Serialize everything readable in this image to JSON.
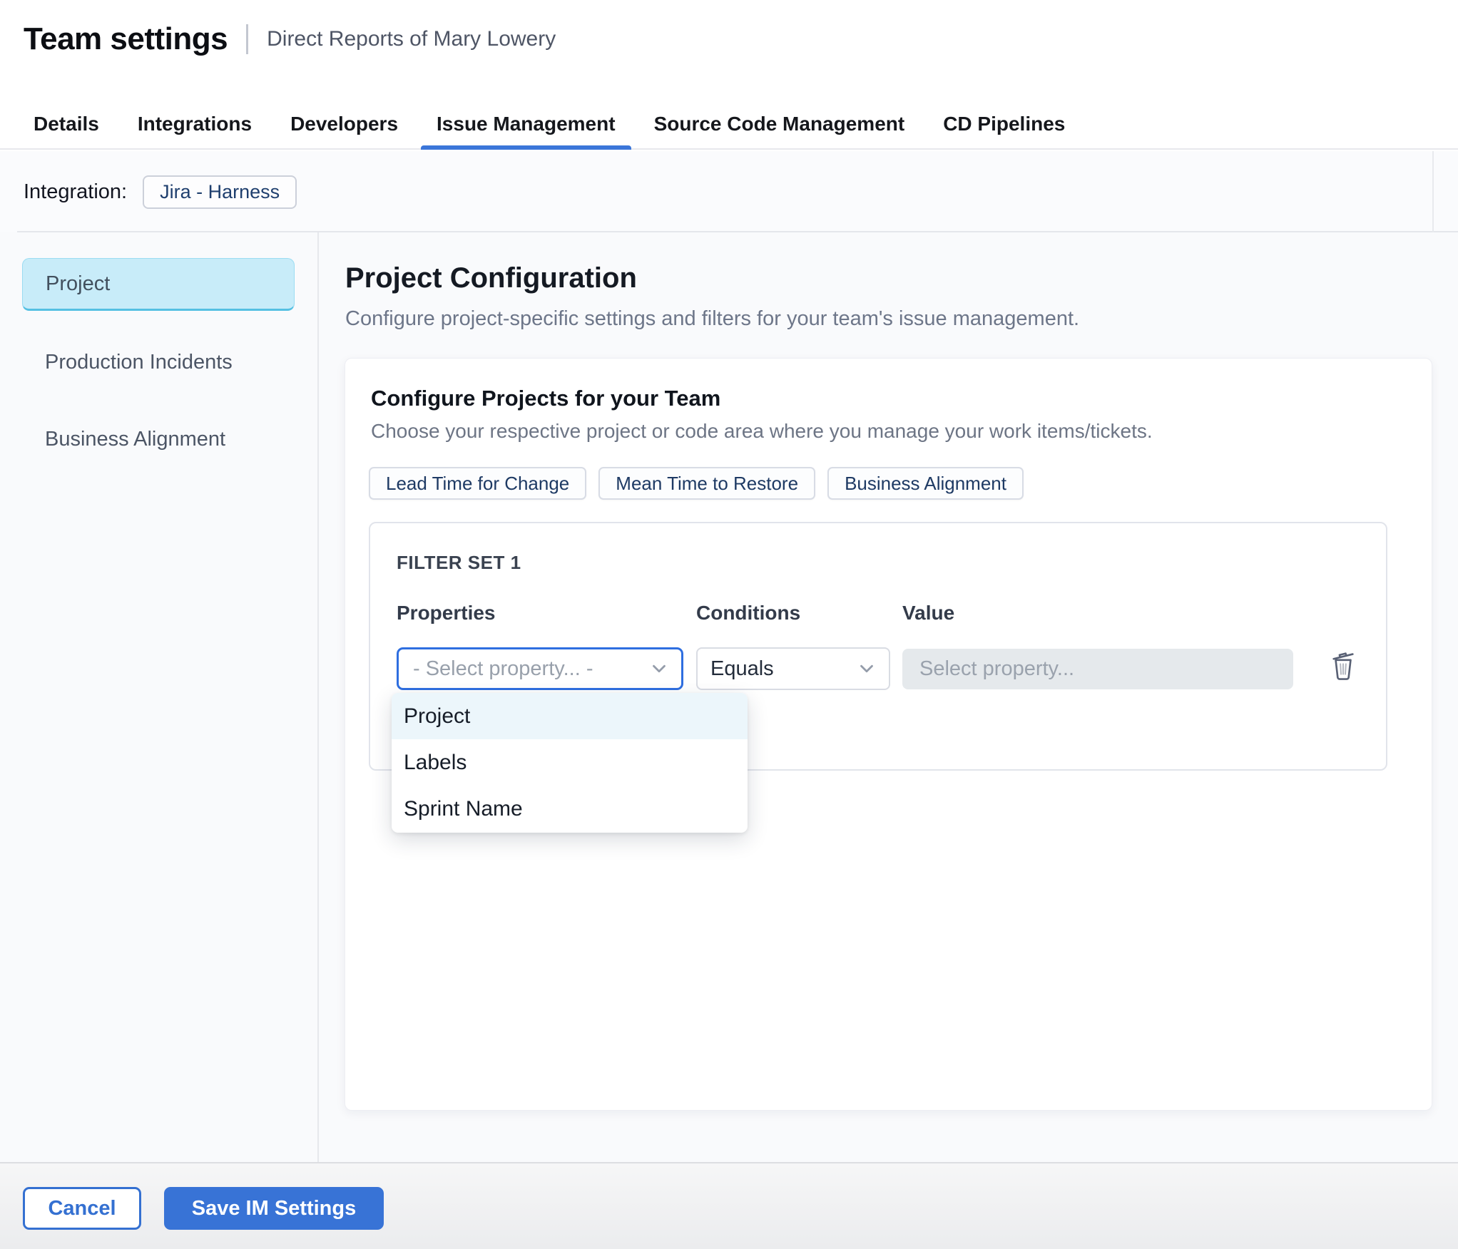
{
  "header": {
    "title": "Team settings",
    "subtitle": "Direct Reports of Mary Lowery"
  },
  "tabs": [
    {
      "label": "Details",
      "active": false
    },
    {
      "label": "Integrations",
      "active": false
    },
    {
      "label": "Developers",
      "active": false
    },
    {
      "label": "Issue Management",
      "active": true
    },
    {
      "label": "Source Code Management",
      "active": false
    },
    {
      "label": "CD Pipelines",
      "active": false
    }
  ],
  "integration": {
    "label": "Integration:",
    "chip_label": "Jira - Harness"
  },
  "sidebar": {
    "items": [
      {
        "label": "Project",
        "selected": true
      },
      {
        "label": "Production Incidents",
        "selected": false
      },
      {
        "label": "Business Alignment",
        "selected": false
      }
    ]
  },
  "main": {
    "title": "Project Configuration",
    "description": "Configure project-specific settings and filters for your team's issue management.",
    "card": {
      "title": "Configure Projects for your Team",
      "subtitle": "Choose your respective project or code area where you manage your work items/tickets.",
      "metric_buttons": [
        "Lead Time for Change",
        "Mean Time to Restore",
        "Business Alignment"
      ],
      "filter_set": {
        "title": "FILTER SET 1",
        "columns": [
          "Properties",
          "Conditions",
          "Value"
        ],
        "property_select": {
          "value": "- Select property... -"
        },
        "condition_select": {
          "value": "Equals"
        },
        "value_input": {
          "placeholder": "Select property..."
        },
        "dropdown_options": [
          {
            "label": "Project",
            "highlighted": true
          },
          {
            "label": "Labels",
            "highlighted": false
          },
          {
            "label": "Sprint Name",
            "highlighted": false
          }
        ]
      }
    }
  },
  "footer": {
    "cancel_label": "Cancel",
    "save_label": "Save IM Settings"
  },
  "icons": {
    "property_select": "chevron-down",
    "condition_select": "chevron-down",
    "delete_filter": "trash"
  },
  "colors": {
    "accent_blue": "#3b76d9",
    "primary_button": "#3873d6",
    "selected_sidebar_bg": "#c8ecf9",
    "sidebar_selected_border": "#55c0e3",
    "dropdown_highlight": "#ecf6fb",
    "value_input_bg": "#e5e9ec",
    "chip_text": "#1e3a64"
  }
}
